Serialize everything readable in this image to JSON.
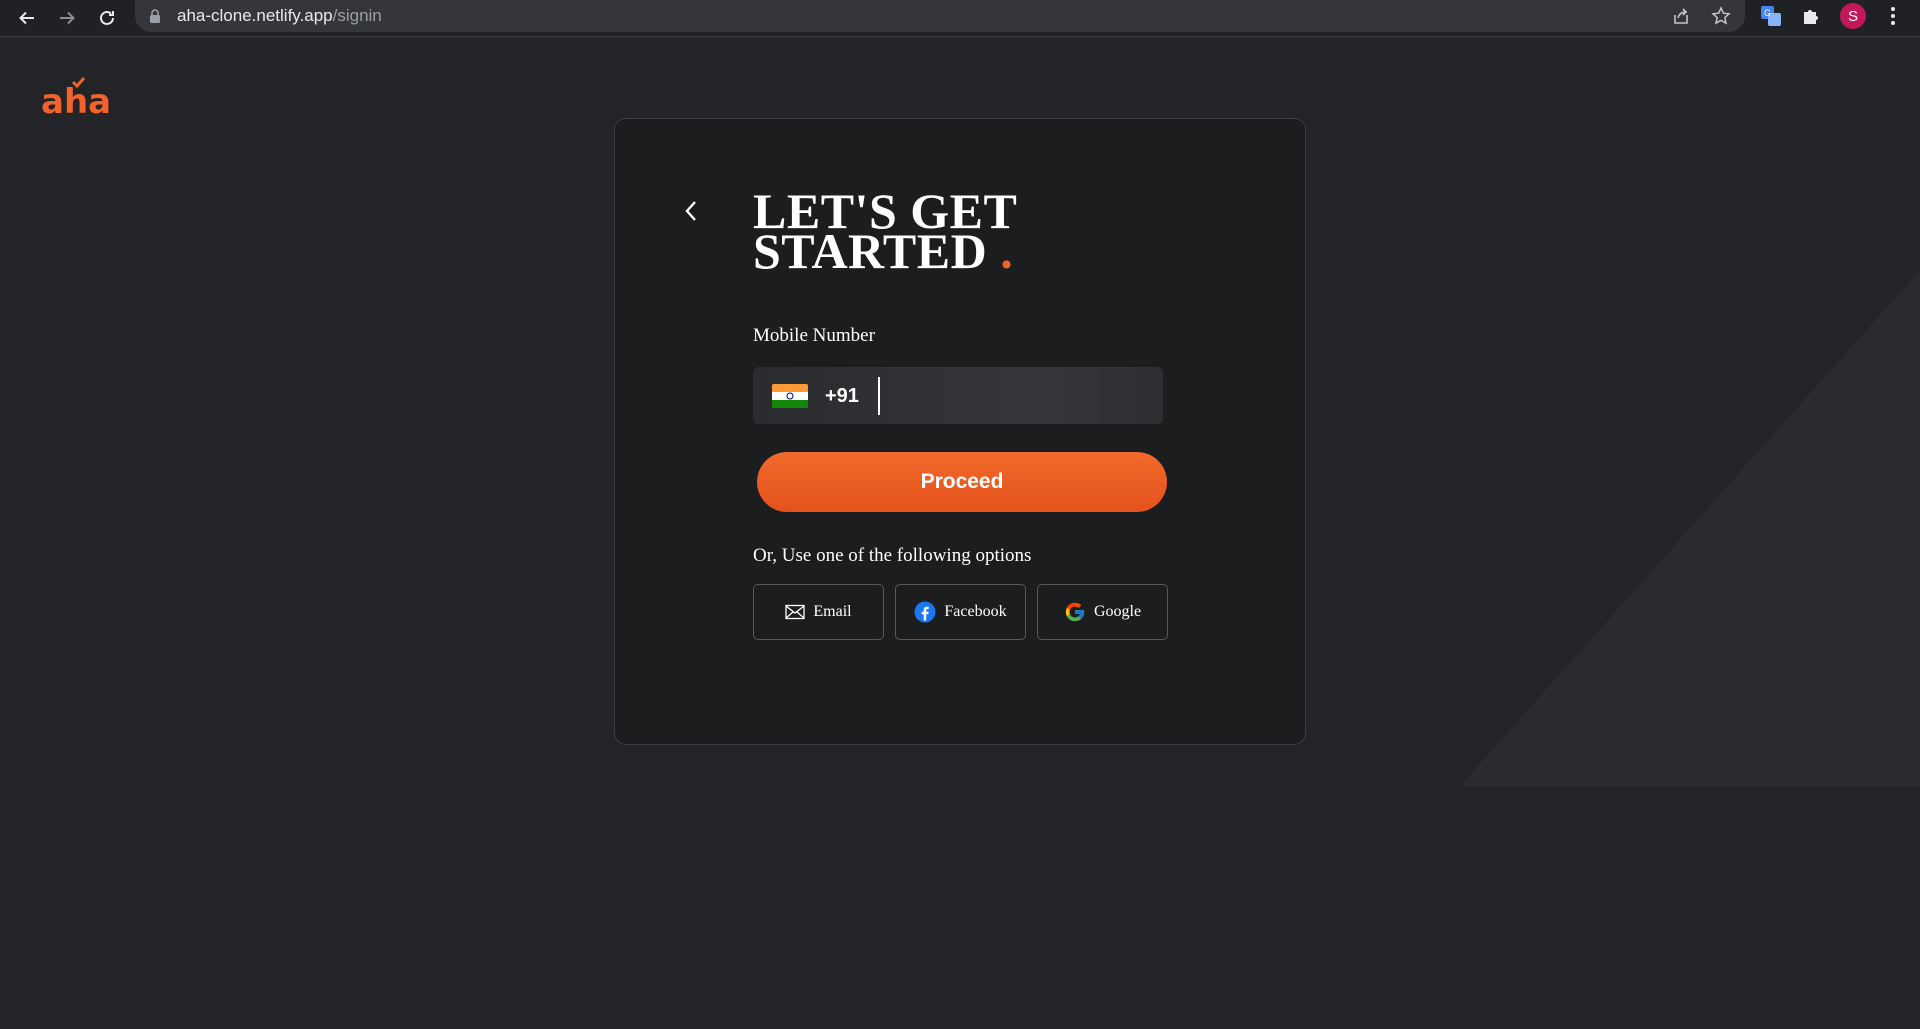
{
  "browser": {
    "url_host": "aha-clone.netlify.app",
    "url_path": "/signin",
    "profile_initial": "S"
  },
  "brand": {
    "logo_text": "aha",
    "accent_color": "#f1632a"
  },
  "signin": {
    "heading_line1": "LET'S GET",
    "heading_line2": "STARTED",
    "heading_dot": ".",
    "mobile_label": "Mobile Number",
    "country_code": "+91",
    "phone_value": "",
    "proceed_label": "Proceed",
    "options_label": "Or, Use one of the following options",
    "options": [
      {
        "label": "Email",
        "icon": "envelope-icon"
      },
      {
        "label": "Facebook",
        "icon": "facebook-icon"
      },
      {
        "label": "Google",
        "icon": "google-icon"
      }
    ]
  }
}
